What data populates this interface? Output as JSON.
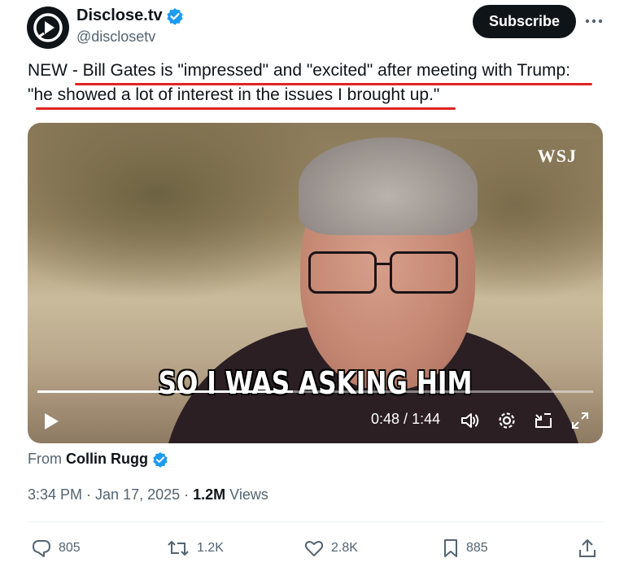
{
  "author": {
    "name": "Disclose.tv",
    "handle": "@disclosetv",
    "verified": true
  },
  "subscribe_label": "Subscribe",
  "tweet": {
    "line1": "NEW - Bill Gates is \"impressed\" and \"excited\" after meeting with Trump:",
    "line2": "\"he showed a lot of interest in the issues I brought up.\""
  },
  "media": {
    "watermark": "WSJ",
    "caption": "SO I WAS ASKING HIM",
    "current_time": "0:48",
    "separator": " / ",
    "duration": "1:44",
    "progress_fraction": 0.46
  },
  "attribution": {
    "prefix": "From",
    "name": "Collin Rugg"
  },
  "meta": {
    "time": "3:34 PM",
    "sep1": " · ",
    "date": "Jan 17, 2025",
    "sep2": " · ",
    "views_count": "1.2M",
    "views_label": " Views"
  },
  "actions": {
    "replies": "805",
    "reposts": "1.2K",
    "likes": "2.8K",
    "bookmarks": "885"
  },
  "colors": {
    "verified": "#1d9bf0",
    "underline": "#e02424",
    "text_secondary": "#536471"
  }
}
